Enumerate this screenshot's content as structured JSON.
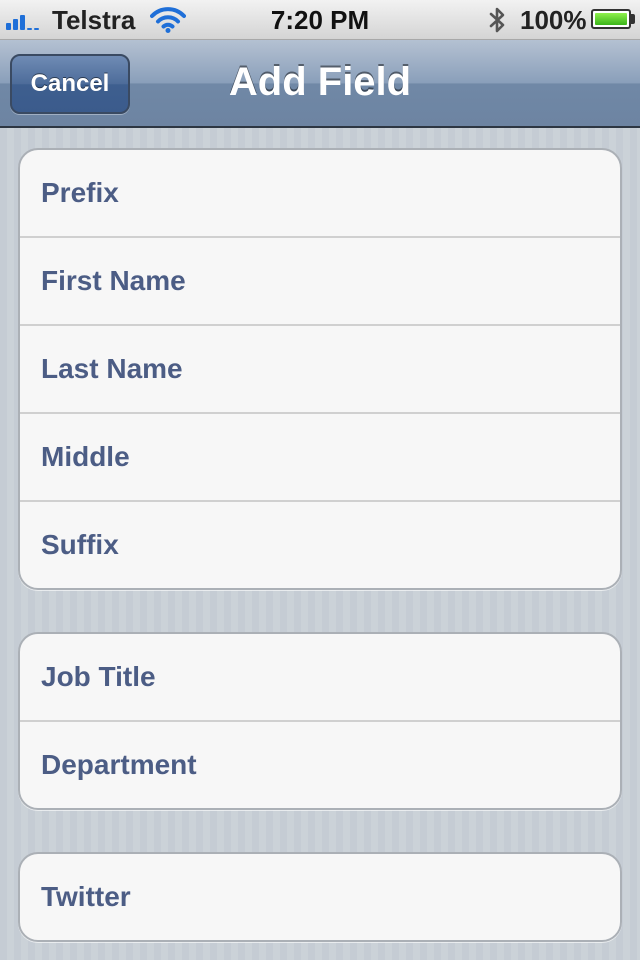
{
  "status_bar": {
    "carrier": "Telstra",
    "time": "7:20 PM",
    "battery_percent": "100%",
    "battery_level": 1.0,
    "signal_bars": 3,
    "icons": [
      "signal-icon",
      "wifi-icon",
      "bluetooth-icon",
      "battery-icon"
    ]
  },
  "nav_bar": {
    "title": "Add Field",
    "cancel_label": "Cancel"
  },
  "groups": [
    {
      "rows": [
        "Prefix",
        "First Name",
        "Last Name",
        "Middle",
        "Suffix"
      ]
    },
    {
      "rows": [
        "Job Title",
        "Department"
      ]
    },
    {
      "rows": [
        "Twitter"
      ]
    }
  ],
  "colors": {
    "row_text": "#4c5d85",
    "nav_bar": "#6d84a2",
    "cancel_button": "#3b5b8c",
    "battery_fill": "#3ab51a"
  }
}
